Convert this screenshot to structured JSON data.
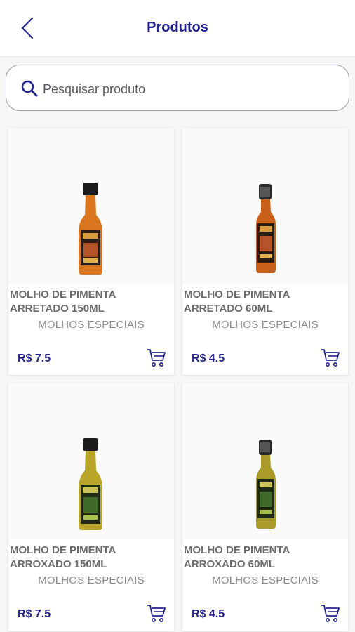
{
  "header": {
    "title": "Produtos",
    "back_icon": "chevron-left-icon"
  },
  "search": {
    "placeholder": "Pesquisar produto",
    "icon": "search-icon"
  },
  "products": [
    {
      "name": "MOLHO DE PIMENTA ARRETADO 150ML",
      "category": "MOLHOS ESPECIAIS",
      "price": "R$ 7.5",
      "liquid_color": "#d9741f",
      "size": "150ML"
    },
    {
      "name": "MOLHO DE PIMENTA ARRETADO 60ML",
      "category": "MOLHOS ESPECIAIS",
      "price": "R$ 4.5",
      "liquid_color": "#c8601a",
      "size": "60ML"
    },
    {
      "name": "MOLHO DE PIMENTA ARROXADO 150ML",
      "category": "MOLHOS ESPECIAIS",
      "price": "R$ 7.5",
      "liquid_color": "#b9a52a",
      "size": "150ML"
    },
    {
      "name": "MOLHO DE PIMENTA ARROXADO 60ML",
      "category": "MOLHOS ESPECIAIS",
      "price": "R$ 4.5",
      "liquid_color": "#a99a2a",
      "size": "60ML"
    }
  ],
  "colors": {
    "accent": "#23248c",
    "background": "#f6f6f8"
  }
}
